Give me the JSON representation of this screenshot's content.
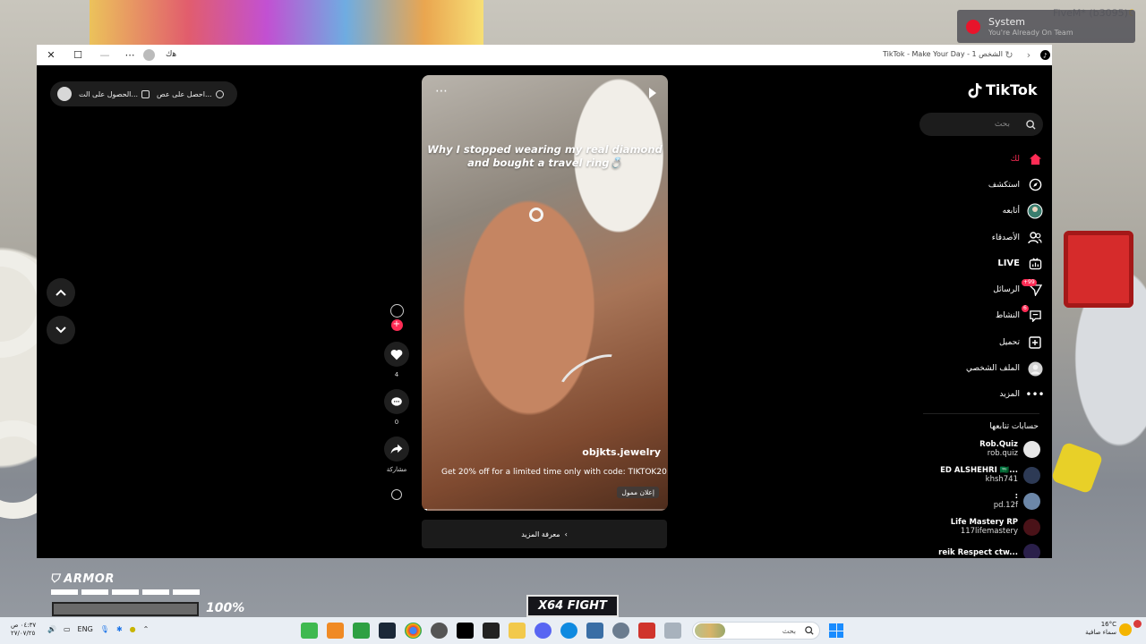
{
  "colors": {
    "accent": "#fe2c55",
    "window_bg": "#000000",
    "taskbar_bg": "#e9eef4"
  },
  "notification": {
    "title": "System",
    "message": "You're Already On Team",
    "server": "FiveM* (b3095)"
  },
  "hud": {
    "armor_label": "ARMOR",
    "armor_percent": "100%",
    "logo": "X64 FIGHT"
  },
  "window": {
    "title": "TikTok - Make Your Day - الشخص 1",
    "shortcut_label": "ﻫﻙ"
  },
  "top_pill": {
    "item1": "احصل على عص...",
    "item2": "الحصول على الت..."
  },
  "video": {
    "caption_line1": "Why I stopped wearing my real diamond",
    "caption_line2": "and bought a travel ring💍",
    "author": "objkts.jewelry",
    "ad_text": "Get 20% off for a limited time only with code: TIKTOK20",
    "sponsored_label": "إعلان ممول",
    "progress": 0.02,
    "learn_more": "معرفة المزيد"
  },
  "actions": {
    "likes": "4",
    "comments": "0",
    "share_label": "مشاركة"
  },
  "sidebar": {
    "logo": "TikTok",
    "search_placeholder": "بحث",
    "menu": [
      {
        "label": "لك",
        "icon": "home-icon",
        "active": true
      },
      {
        "label": "استكشف",
        "icon": "compass-icon"
      },
      {
        "label": "أتابعه",
        "icon": "following-avatar-icon"
      },
      {
        "label": "الأصدقاء",
        "icon": "friends-icon"
      },
      {
        "label": "LIVE",
        "icon": "live-icon"
      },
      {
        "label": "الرسائل",
        "icon": "messages-icon",
        "badge": "+99"
      },
      {
        "label": "النشاط",
        "icon": "activity-icon",
        "badge": "6"
      },
      {
        "label": "تحميل",
        "icon": "upload-icon"
      },
      {
        "label": "الملف الشخصي",
        "icon": "profile-icon"
      },
      {
        "label": "المزيد",
        "icon": "more-icon"
      }
    ],
    "following_title": "حسابات تتابعها",
    "accounts": [
      {
        "name": "Rob.Quiz",
        "handle": "rob.quiz",
        "color": "#e6e6e6"
      },
      {
        "name": "ED ALSHEHRI 🇸🇦...",
        "handle": "khsh741",
        "color": "#2d3a55"
      },
      {
        "name": ":",
        "handle": "pd.12f",
        "color": "#6c87a8"
      },
      {
        "name": "Life Mastery RP",
        "handle": "117lifemastery",
        "color": "#4a1218"
      },
      {
        "name": "reik Respect ctw...",
        "handle": "",
        "color": "#2a1f4a"
      }
    ]
  },
  "taskbar": {
    "time": "٠٤:٣٧ ص",
    "date": "٢٧/٠٧/٢٥",
    "language": "ENG",
    "search_placeholder": "بحث",
    "temperature": "16°C",
    "weather": "سماء صافية"
  }
}
